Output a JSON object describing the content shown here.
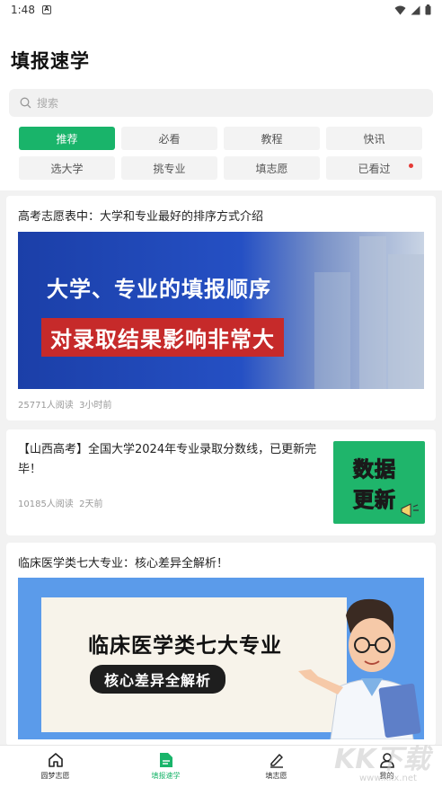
{
  "status_bar": {
    "time": "1:48",
    "notification_glyph": "A"
  },
  "page": {
    "title": "填报速学"
  },
  "search": {
    "placeholder": "搜索"
  },
  "tabs": [
    {
      "label": "推荐",
      "active": true
    },
    {
      "label": "必看"
    },
    {
      "label": "教程"
    },
    {
      "label": "快讯"
    },
    {
      "label": "选大学"
    },
    {
      "label": "挑专业"
    },
    {
      "label": "填志愿"
    },
    {
      "label": "已看过",
      "badge_dot": true
    }
  ],
  "articles": [
    {
      "title": "高考志愿表中：大学和专业最好的排序方式介绍",
      "banner_line1": "大学、专业的填报顺序",
      "banner_line2": "对录取结果影响非常大",
      "reads": "25771人阅读",
      "time": "3小时前"
    },
    {
      "title": "【山西高考】全国大学2024年专业录取分数线，已更新完毕！",
      "thumb_line1": "数据",
      "thumb_line2": "更新",
      "reads": "10185人阅读",
      "time": "2天前"
    },
    {
      "title": "临床医学类七大专业：核心差异全解析！",
      "banner_line1": "临床医学类七大专业",
      "banner_line2": "核心差异全解析"
    }
  ],
  "bottom_nav": [
    {
      "label": "圆梦志愿",
      "icon": "home-icon"
    },
    {
      "label": "填报速学",
      "icon": "document-icon",
      "active": true
    },
    {
      "label": "填志愿",
      "icon": "pencil-icon"
    },
    {
      "label": "我的",
      "icon": "user-icon"
    }
  ],
  "watermark": {
    "text": "KK下载",
    "url": "www.kkx.net"
  },
  "colors": {
    "accent": "#19b46a",
    "badge": "#e53935"
  }
}
